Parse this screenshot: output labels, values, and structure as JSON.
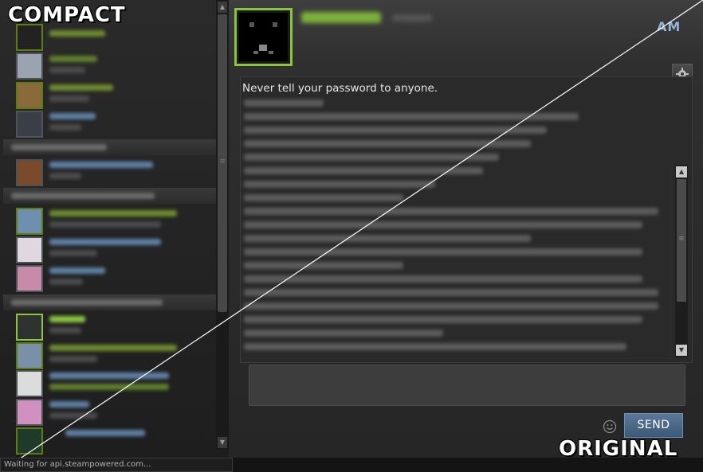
{
  "labels": {
    "compact": "COMPACT",
    "original": "ORIGINAL"
  },
  "chat": {
    "password_warning": "Never tell your password to anyone.",
    "send_label": "SEND",
    "brand_fragment": "AM"
  },
  "status_bar": {
    "text": "Waiting for api.steampowered.com..."
  },
  "icons": {
    "settings": "gear-icon",
    "emoticon": "smiley-icon",
    "scroll_up": "arrow-up-icon",
    "scroll_down": "arrow-down-icon"
  },
  "colors": {
    "online_green": "#8bc53f",
    "send_button": "#4a6a8e",
    "background": "#262626"
  }
}
